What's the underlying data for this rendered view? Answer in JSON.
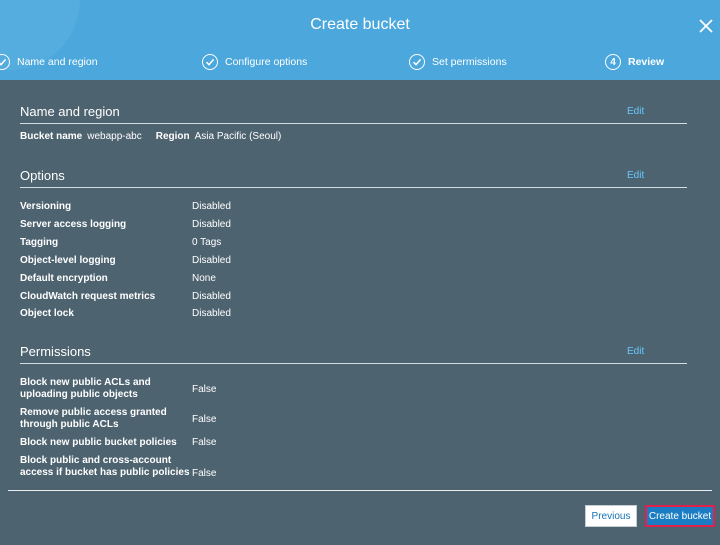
{
  "dialog": {
    "title": "Create bucket"
  },
  "steps": [
    {
      "label": "Name and region",
      "state": "done"
    },
    {
      "label": "Configure options",
      "state": "done"
    },
    {
      "label": "Set permissions",
      "state": "done"
    },
    {
      "number": "4",
      "label": "Review",
      "state": "current"
    }
  ],
  "sections": {
    "name_region": {
      "title": "Name and region",
      "edit": "Edit",
      "bucket_name_label": "Bucket name",
      "bucket_name_value": "webapp-abc",
      "region_label": "Region",
      "region_value": "Asia Pacific (Seoul)"
    },
    "options": {
      "title": "Options",
      "edit": "Edit",
      "rows": [
        {
          "label": "Versioning",
          "value": "Disabled"
        },
        {
          "label": "Server access logging",
          "value": "Disabled"
        },
        {
          "label": "Tagging",
          "value": "0 Tags"
        },
        {
          "label": "Object-level logging",
          "value": "Disabled"
        },
        {
          "label": "Default encryption",
          "value": "None"
        },
        {
          "label": "CloudWatch request metrics",
          "value": "Disabled"
        },
        {
          "label": "Object lock",
          "value": "Disabled"
        }
      ]
    },
    "permissions": {
      "title": "Permissions",
      "edit": "Edit",
      "rows": [
        {
          "label": "Block new public ACLs and uploading public objects",
          "value": "False"
        },
        {
          "label": "Remove public access granted through public ACLs",
          "value": "False"
        },
        {
          "label": "Block new public bucket policies",
          "value": "False"
        },
        {
          "label": "Block public and cross-account access if bucket has public policies",
          "value": "False"
        }
      ]
    }
  },
  "footer": {
    "previous": "Previous",
    "create": "Create bucket"
  },
  "colors": {
    "header": "#4ba7dc",
    "body": "#4e6370",
    "link": "#66c8ff",
    "primary_button": "#1a7dc4",
    "highlight_border": "#e0224a"
  },
  "icons": {
    "step_done": "check-circle-icon",
    "close": "close-icon"
  }
}
